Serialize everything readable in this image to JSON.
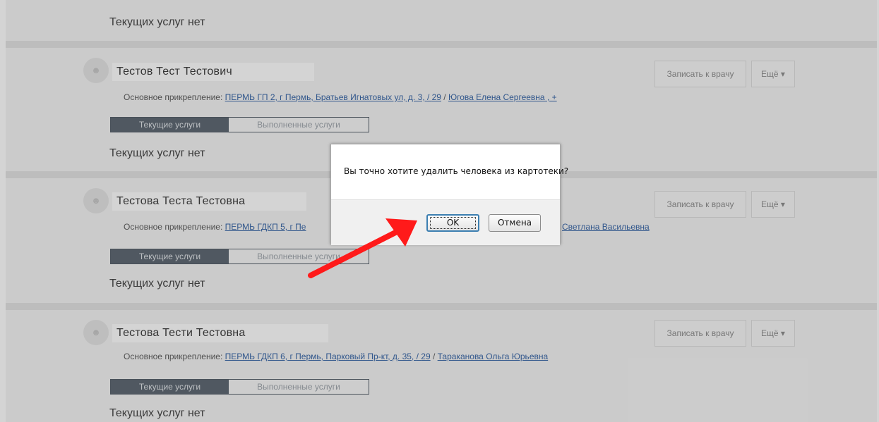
{
  "top_card": {
    "empty_text": "Текущих услуг нет"
  },
  "patients": [
    {
      "name": "Тестов Тест Тестович",
      "attach_label": "Основное прикрепление:",
      "clinic_link": "ПЕРМЬ ГП 2, г Пермь, Братьев Игнатовых ул, д. 3, ",
      "sep1": "/ ",
      "area_link": "29",
      "sep2": " / ",
      "doctor_link": "Югова Елена Сергеевна ",
      "suffix": ", +",
      "tab_current": "Текущие услуги",
      "tab_done": "Выполненные услуги",
      "empty_text": "Текущих услуг нет",
      "book_button": "Записать к врачу",
      "more_button": "Ещё ▾"
    },
    {
      "name": "Тестова Теста Тестовна",
      "attach_label": "Основное прикрепление:",
      "clinic_link": "ПЕРМЬ ГДКП 5, г Пе",
      "doctor_link_tail": "Светлана Васильевна",
      "tab_current": "Текущие услуги",
      "tab_done": "Выполненные услуги",
      "empty_text": "Текущих услуг нет",
      "book_button": "Записать к врачу",
      "more_button": "Ещё ▾"
    },
    {
      "name": "Тестова Тести Тестовна",
      "attach_label": "Основное прикрепление:",
      "clinic_link": "ПЕРМЬ ГДКП 6, г Пермь, Парковый Пр-кт, д. 35, ",
      "sep1": "/ ",
      "area_link": "29",
      "sep2": " / ",
      "doctor_link": "Тараканова Ольга Юрьевна",
      "tab_current": "Текущие услуги",
      "tab_done": "Выполненные услуги",
      "empty_text": "Текущих услуг нет",
      "book_button": "Записать к врачу",
      "more_button": "Ещё ▾"
    }
  ],
  "dialog": {
    "message": "Вы точно хотите удалить человека из картотеки?",
    "ok_label": "OK",
    "cancel_label": "Отмена"
  },
  "icons": {
    "avatar": "user-icon",
    "annotation": "red-arrow-icon"
  },
  "colors": {
    "arrow": "#ff1a1a",
    "link": "#2f5fa3",
    "active_tab": "#56616c"
  }
}
